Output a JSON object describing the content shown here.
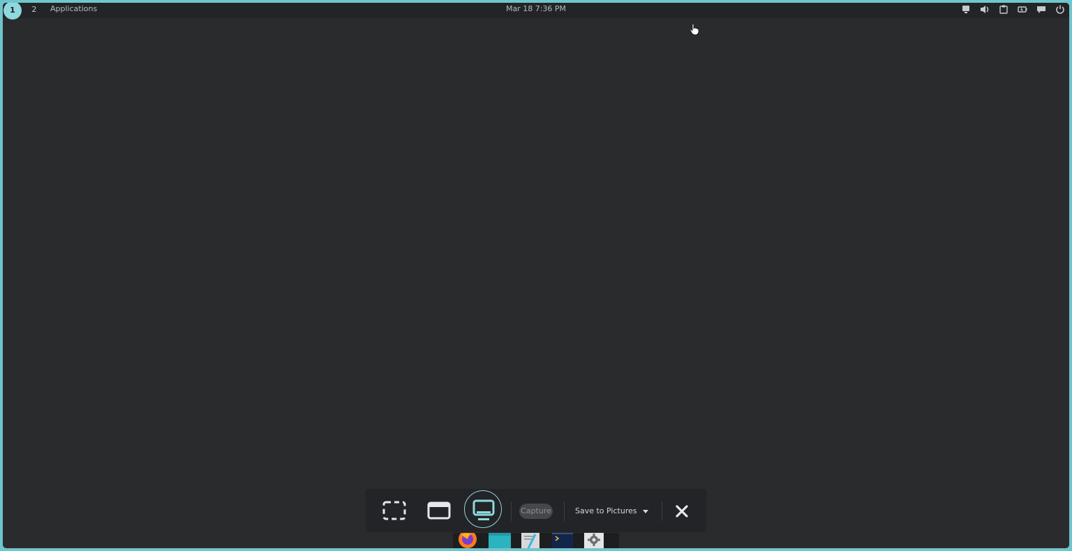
{
  "topbar": {
    "workspaces": [
      {
        "label": "1",
        "active": true
      },
      {
        "label": "2",
        "active": false
      }
    ],
    "applications_label": "Applications",
    "clock": "Mar 18  7:36 PM",
    "tray_icons": [
      "display-icon",
      "volume-icon",
      "clipboard-icon",
      "battery-icon",
      "notifications-icon",
      "power-icon"
    ]
  },
  "screenshot_toolbar": {
    "modes": [
      {
        "name": "region-select-icon",
        "active": false
      },
      {
        "name": "window-icon",
        "active": false
      },
      {
        "name": "screen-icon",
        "active": true
      }
    ],
    "capture_label": "Capture",
    "save_label": "Save to Pictures"
  },
  "dock": {
    "apps": [
      "firefox-icon",
      "files-icon",
      "text-editor-icon",
      "terminal-icon",
      "settings-icon"
    ]
  },
  "colors": {
    "accent": "#8fd8dd",
    "border": "#6fc6cc",
    "desktop": "#2a2b2d",
    "panel": "#232427"
  }
}
